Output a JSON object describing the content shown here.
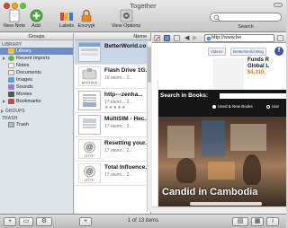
{
  "window": {
    "title": "Together"
  },
  "toolbar": {
    "new_note": "New Note",
    "add": "Add",
    "labels": "Labels",
    "encrypt": "Encrypt",
    "view_options": "View Options",
    "search_label": "Search"
  },
  "sidebar": {
    "header": "Groups",
    "library_section": "LIBRARY",
    "items": [
      {
        "label": "Library",
        "color": "#f0c040"
      },
      {
        "label": "Recent Imports",
        "color": "#6ab04c"
      },
      {
        "label": "Notes",
        "color": "#f2f2f2"
      },
      {
        "label": "Documents",
        "color": "#e9e9e9"
      },
      {
        "label": "Images",
        "color": "#5fa0d8"
      },
      {
        "label": "Sounds",
        "color": "#9b7fd1"
      },
      {
        "label": "Movies",
        "color": "#555555"
      },
      {
        "label": "Bookmarks",
        "color": "#c24a4a"
      }
    ],
    "groups_section": "GROUPS",
    "trash_section": "TRASH",
    "trash_item": "Trash"
  },
  "list": {
    "header": "Name",
    "rows": [
      {
        "title": "BetterWorld.co...",
        "date": "",
        "stars": "",
        "thumb": "web"
      },
      {
        "title": "Flash Drive 1G...",
        "date": "19 июля... 2...",
        "stars": "",
        "thumb": "archive",
        "thumb_label": "ARCHIVE"
      },
      {
        "title": "http---zenha...",
        "date": "17 июля... 2...",
        "stars": "★★★★★",
        "thumb": "doc"
      },
      {
        "title": "MultiSIM - Hec...",
        "date": "17 июля... 2...",
        "stars": "",
        "thumb": "doc"
      },
      {
        "title": "Resetting your...",
        "date": "17 июля... 2...",
        "stars": "",
        "thumb": "http",
        "thumb_label": "HTTP"
      },
      {
        "title": "Total Influence...",
        "date": "17 июля... 2...",
        "stars": "",
        "thumb": "http",
        "thumb_label": "HTTP"
      }
    ]
  },
  "browser": {
    "url": "http://www.be",
    "tabs": [
      "Videos",
      "BetterWorld Blog"
    ],
    "funds_line1": "Funds R",
    "funds_line2": "Global L",
    "funds_amount": "$4,310,",
    "search_title": "Search in Books:",
    "radio_used": "Used & New Books",
    "radio_other": "Use",
    "caption": "Candid in Cambodia"
  },
  "bottombar": {
    "count": "1 of 13 items"
  }
}
